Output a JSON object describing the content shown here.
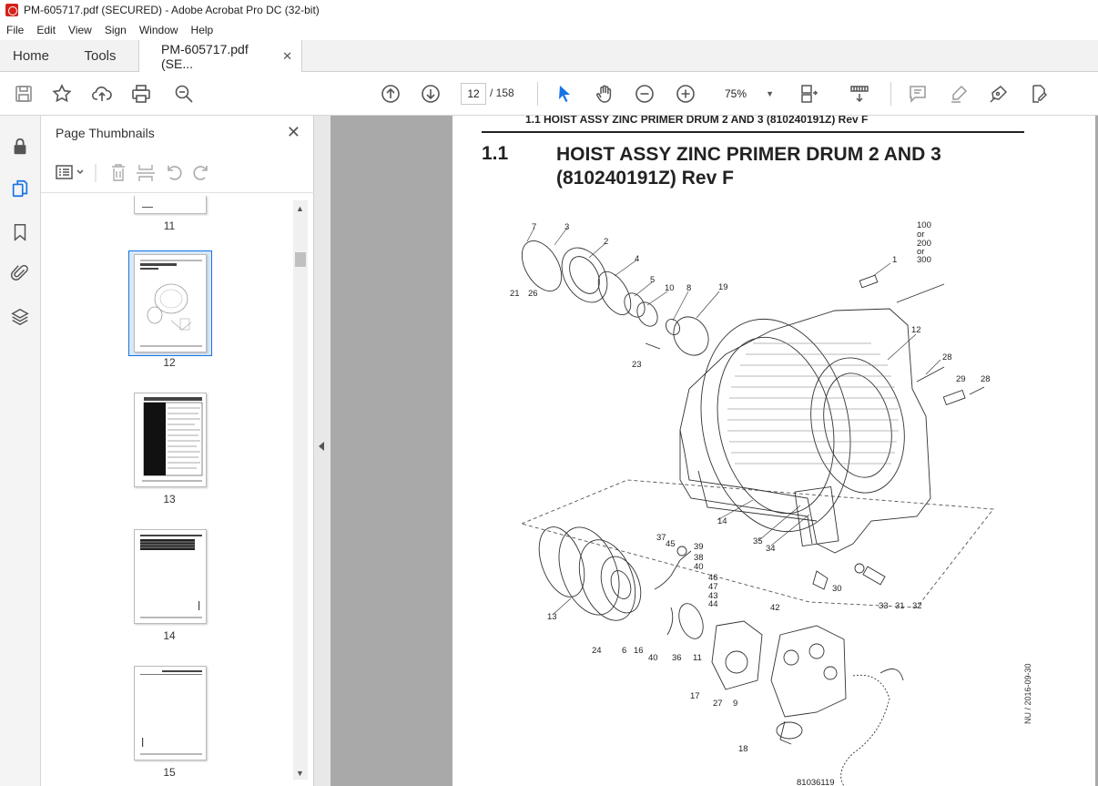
{
  "window": {
    "title": "PM-605717.pdf (SECURED) - Adobe Acrobat Pro DC (32-bit)"
  },
  "menu": [
    "File",
    "Edit",
    "View",
    "Sign",
    "Window",
    "Help"
  ],
  "tabs": {
    "home": "Home",
    "tools": "Tools",
    "document": "PM-605717.pdf (SE..."
  },
  "toolbar": {
    "current_page": "12",
    "total_pages": "/ 158",
    "zoom": "75%"
  },
  "panel": {
    "title": "Page Thumbnails",
    "thumbnails": [
      {
        "label": "11"
      },
      {
        "label": "12"
      },
      {
        "label": "13"
      },
      {
        "label": "14"
      },
      {
        "label": "15"
      }
    ]
  },
  "page": {
    "running_header": "1.1 HOIST ASSY ZINC PRIMER DRUM 2 AND 3 (810240191Z) Rev F",
    "section_number": "1.1",
    "section_title_line1": "HOIST ASSY ZINC PRIMER DRUM 2 AND 3",
    "section_title_line2": "(810240191Z) Rev F",
    "side_text": "NU / 2016-09-30",
    "bottom_text": "81036119",
    "callouts": [
      "7",
      "3",
      "2",
      "4",
      "5",
      "10",
      "8",
      "19",
      "21",
      "26",
      "100",
      "or",
      "200",
      "or",
      "300",
      "1",
      "12",
      "23",
      "28",
      "29",
      "28",
      "14",
      "35",
      "34",
      "37",
      "45",
      "39",
      "38",
      "40",
      "46",
      "47",
      "43",
      "44",
      "30",
      "33",
      "31",
      "32",
      "13",
      "42",
      "24",
      "6",
      "16",
      "40",
      "36",
      "11",
      "17",
      "27",
      "9",
      "18"
    ]
  },
  "colors": {
    "accent": "#1473e6",
    "viewer_bg": "#a9a9a9"
  }
}
